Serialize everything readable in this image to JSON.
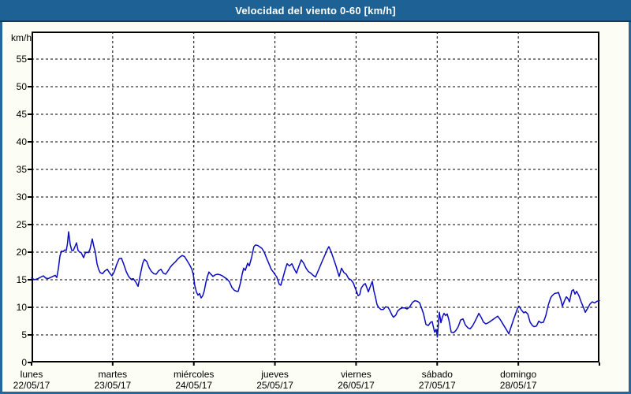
{
  "window": {
    "title": "Velocidad del viento 0-60 [km/h]"
  },
  "colors": {
    "header_bg": "#1e6295",
    "header_border": "#0e3c5f",
    "frame_border": "#28679c",
    "content_bg": "#fcfdf5",
    "plot_bg": "#ffffff",
    "grid": "#000000",
    "axis": "#000000",
    "line": "#0b0bc0"
  },
  "chart_data": {
    "type": "line",
    "title": "Velocidad del viento 0-60 [km/h]",
    "ylabel": "km/h",
    "ylim": [
      0,
      60
    ],
    "ytick_step": 5,
    "ytick_labels": [
      0,
      5,
      10,
      15,
      20,
      25,
      30,
      35,
      40,
      45,
      50,
      55
    ],
    "grid": "dashed",
    "legend": "none",
    "x_days": [
      {
        "name": "lunes",
        "date": "22/05/17"
      },
      {
        "name": "martes",
        "date": "23/05/17"
      },
      {
        "name": "miércoles",
        "date": "24/05/17"
      },
      {
        "name": "jueves",
        "date": "25/05/17"
      },
      {
        "name": "viernes",
        "date": "26/05/17"
      },
      {
        "name": "sábado",
        "date": "27/05/17"
      },
      {
        "name": "domingo",
        "date": "28/05/17"
      }
    ],
    "xlim_days": [
      0,
      7
    ],
    "series": [
      {
        "name": "Velocidad del viento",
        "units": "km/h",
        "points": [
          [
            0,
            15.3
          ],
          [
            0.039,
            15
          ],
          [
            0.078,
            15.2
          ],
          [
            0.117,
            15.5
          ],
          [
            0.146,
            15.7
          ],
          [
            0.175,
            15.3
          ],
          [
            0.204,
            15.2
          ],
          [
            0.233,
            15.4
          ],
          [
            0.262,
            15.6
          ],
          [
            0.292,
            15.8
          ],
          [
            0.311,
            15.4
          ],
          [
            0.331,
            17
          ],
          [
            0.35,
            19.3
          ],
          [
            0.369,
            20.2
          ],
          [
            0.389,
            20.1
          ],
          [
            0.408,
            20.4
          ],
          [
            0.428,
            20.3
          ],
          [
            0.442,
            21.5
          ],
          [
            0.457,
            23.7
          ],
          [
            0.476,
            21.4
          ],
          [
            0.496,
            20.3
          ],
          [
            0.515,
            20.3
          ],
          [
            0.535,
            21
          ],
          [
            0.554,
            21.7
          ],
          [
            0.574,
            20.3
          ],
          [
            0.593,
            20
          ],
          [
            0.612,
            19.9
          ],
          [
            0.642,
            19
          ],
          [
            0.661,
            19.8
          ],
          [
            0.681,
            20
          ],
          [
            0.7,
            19.9
          ],
          [
            0.719,
            20.5
          ],
          [
            0.749,
            22.4
          ],
          [
            0.768,
            21
          ],
          [
            0.787,
            20
          ],
          [
            0.807,
            17.9
          ],
          [
            0.826,
            16.9
          ],
          [
            0.846,
            16.3
          ],
          [
            0.875,
            16.1
          ],
          [
            0.904,
            16.6
          ],
          [
            0.933,
            16.9
          ],
          [
            0.963,
            16.2
          ],
          [
            0.992,
            15.7
          ],
          [
            1.021,
            16.5
          ],
          [
            1.05,
            17.8
          ],
          [
            1.079,
            18.8
          ],
          [
            1.108,
            18.9
          ],
          [
            1.137,
            17.8
          ],
          [
            1.167,
            16.5
          ],
          [
            1.196,
            15.6
          ],
          [
            1.225,
            15.1
          ],
          [
            1.254,
            15.2
          ],
          [
            1.283,
            14.6
          ],
          [
            1.313,
            13.8
          ],
          [
            1.342,
            16
          ],
          [
            1.371,
            18
          ],
          [
            1.39,
            18.7
          ],
          [
            1.42,
            18.3
          ],
          [
            1.449,
            17.2
          ],
          [
            1.478,
            16.5
          ],
          [
            1.507,
            16.1
          ],
          [
            1.536,
            16
          ],
          [
            1.565,
            16.6
          ],
          [
            1.595,
            16.9
          ],
          [
            1.624,
            16.2
          ],
          [
            1.653,
            16
          ],
          [
            1.682,
            16.6
          ],
          [
            1.711,
            17.3
          ],
          [
            1.74,
            17.8
          ],
          [
            1.77,
            18.2
          ],
          [
            1.799,
            18.7
          ],
          [
            1.828,
            19.1
          ],
          [
            1.857,
            19.4
          ],
          [
            1.886,
            19.2
          ],
          [
            1.915,
            18.5
          ],
          [
            1.944,
            17.8
          ],
          [
            1.974,
            17
          ],
          [
            1.993,
            16
          ],
          [
            2.012,
            14
          ],
          [
            2.032,
            12.8
          ],
          [
            2.051,
            12.2
          ],
          [
            2.071,
            12.5
          ],
          [
            2.09,
            11.7
          ],
          [
            2.11,
            12.1
          ],
          [
            2.129,
            13
          ],
          [
            2.149,
            14.5
          ],
          [
            2.168,
            15.6
          ],
          [
            2.187,
            16.4
          ],
          [
            2.217,
            15.9
          ],
          [
            2.236,
            15.6
          ],
          [
            2.265,
            15.9
          ],
          [
            2.294,
            16
          ],
          [
            2.324,
            15.9
          ],
          [
            2.353,
            15.7
          ],
          [
            2.382,
            15.4
          ],
          [
            2.411,
            15.1
          ],
          [
            2.44,
            14.6
          ],
          [
            2.469,
            13.6
          ],
          [
            2.499,
            13.1
          ],
          [
            2.528,
            12.9
          ],
          [
            2.547,
            12.9
          ],
          [
            2.576,
            14.5
          ],
          [
            2.596,
            16
          ],
          [
            2.615,
            17.1
          ],
          [
            2.635,
            16.7
          ],
          [
            2.664,
            18
          ],
          [
            2.683,
            17.5
          ],
          [
            2.712,
            19
          ],
          [
            2.741,
            21
          ],
          [
            2.761,
            21.3
          ],
          [
            2.79,
            21.2
          ],
          [
            2.819,
            20.9
          ],
          [
            2.839,
            20.7
          ],
          [
            2.868,
            20
          ],
          [
            2.897,
            18.9
          ],
          [
            2.926,
            17.9
          ],
          [
            2.955,
            16.9
          ],
          [
            2.985,
            16.3
          ],
          [
            3.023,
            15.5
          ],
          [
            3.053,
            14.2
          ],
          [
            3.072,
            14
          ],
          [
            3.101,
            15.5
          ],
          [
            3.13,
            17
          ],
          [
            3.15,
            17.9
          ],
          [
            3.179,
            17.5
          ],
          [
            3.208,
            17.9
          ],
          [
            3.237,
            17
          ],
          [
            3.266,
            16.2
          ],
          [
            3.296,
            17.5
          ],
          [
            3.325,
            18.6
          ],
          [
            3.354,
            18
          ],
          [
            3.383,
            17.1
          ],
          [
            3.412,
            16.5
          ],
          [
            3.442,
            16.2
          ],
          [
            3.471,
            15.8
          ],
          [
            3.5,
            15.5
          ],
          [
            3.529,
            16.5
          ],
          [
            3.558,
            17.5
          ],
          [
            3.587,
            18.5
          ],
          [
            3.617,
            19.5
          ],
          [
            3.646,
            20.5
          ],
          [
            3.665,
            21
          ],
          [
            3.694,
            20
          ],
          [
            3.723,
            18.8
          ],
          [
            3.753,
            17.5
          ],
          [
            3.772,
            16.5
          ],
          [
            3.792,
            15.6
          ],
          [
            3.821,
            17.1
          ],
          [
            3.85,
            16.3
          ],
          [
            3.879,
            16
          ],
          [
            3.908,
            15.2
          ],
          [
            3.937,
            15
          ],
          [
            3.967,
            14.4
          ],
          [
            3.986,
            13.6
          ],
          [
            4.006,
            12.9
          ],
          [
            4.025,
            12.1
          ],
          [
            4.045,
            12.3
          ],
          [
            4.064,
            13.5
          ],
          [
            4.093,
            14.1
          ],
          [
            4.113,
            14.3
          ],
          [
            4.132,
            13.6
          ],
          [
            4.151,
            12.8
          ],
          [
            4.171,
            13.6
          ],
          [
            4.2,
            14.7
          ],
          [
            4.219,
            13
          ],
          [
            4.238,
            11.9
          ],
          [
            4.258,
            10.5
          ],
          [
            4.278,
            10
          ],
          [
            4.307,
            9.6
          ],
          [
            4.336,
            9.6
          ],
          [
            4.365,
            10.1
          ],
          [
            4.394,
            10
          ],
          [
            4.414,
            9.5
          ],
          [
            4.443,
            8.6
          ],
          [
            4.462,
            8.2
          ],
          [
            4.491,
            8.6
          ],
          [
            4.511,
            9.3
          ],
          [
            4.54,
            9.7
          ],
          [
            4.569,
            9.9
          ],
          [
            4.598,
            9.9
          ],
          [
            4.628,
            9.7
          ],
          [
            4.657,
            10
          ],
          [
            4.696,
            10.9
          ],
          [
            4.725,
            11.2
          ],
          [
            4.754,
            11.1
          ],
          [
            4.783,
            10.8
          ],
          [
            4.812,
            9.7
          ],
          [
            4.832,
            8.8
          ],
          [
            4.861,
            6.9
          ],
          [
            4.89,
            6.7
          ],
          [
            4.919,
            7.3
          ],
          [
            4.938,
            7.4
          ],
          [
            4.968,
            5.5
          ],
          [
            4.987,
            6
          ],
          [
            5.002,
            4.6
          ],
          [
            5.026,
            9.1
          ],
          [
            5.046,
            7.2
          ],
          [
            5.065,
            8.3
          ],
          [
            5.085,
            8.9
          ],
          [
            5.104,
            8.5
          ],
          [
            5.124,
            8.8
          ],
          [
            5.143,
            7.8
          ],
          [
            5.172,
            5.5
          ],
          [
            5.202,
            5.4
          ],
          [
            5.231,
            5.8
          ],
          [
            5.26,
            6.5
          ],
          [
            5.289,
            7.7
          ],
          [
            5.318,
            7.9
          ],
          [
            5.347,
            6.8
          ],
          [
            5.377,
            6.3
          ],
          [
            5.406,
            6.1
          ],
          [
            5.435,
            6.6
          ],
          [
            5.464,
            7.4
          ],
          [
            5.494,
            8.3
          ],
          [
            5.513,
            8.9
          ],
          [
            5.542,
            8.2
          ],
          [
            5.571,
            7.3
          ],
          [
            5.6,
            7
          ],
          [
            5.63,
            7.2
          ],
          [
            5.659,
            7.5
          ],
          [
            5.688,
            7.8
          ],
          [
            5.717,
            8.1
          ],
          [
            5.746,
            8.4
          ],
          [
            5.776,
            7.8
          ],
          [
            5.805,
            7.1
          ],
          [
            5.834,
            6.4
          ],
          [
            5.863,
            5.7
          ],
          [
            5.883,
            5.2
          ],
          [
            5.912,
            6.5
          ],
          [
            5.941,
            7.8
          ],
          [
            5.97,
            9
          ],
          [
            5.99,
            9.8
          ],
          [
            6.009,
            10.2
          ],
          [
            6.038,
            9.5
          ],
          [
            6.068,
            9
          ],
          [
            6.087,
            9.2
          ],
          [
            6.116,
            8.8
          ],
          [
            6.145,
            7.3
          ],
          [
            6.174,
            6.7
          ],
          [
            6.194,
            6.5
          ],
          [
            6.223,
            6.6
          ],
          [
            6.252,
            7.5
          ],
          [
            6.281,
            7.2
          ],
          [
            6.31,
            7.3
          ],
          [
            6.339,
            8.5
          ],
          [
            6.369,
            10.4
          ],
          [
            6.398,
            11.7
          ],
          [
            6.417,
            12.1
          ],
          [
            6.446,
            12.5
          ],
          [
            6.475,
            12.6
          ],
          [
            6.495,
            12.7
          ],
          [
            6.524,
            11.4
          ],
          [
            6.543,
            10.2
          ],
          [
            6.572,
            11.3
          ],
          [
            6.592,
            11.9
          ],
          [
            6.611,
            11.6
          ],
          [
            6.631,
            11
          ],
          [
            6.66,
            13
          ],
          [
            6.679,
            13.2
          ],
          [
            6.699,
            12.4
          ],
          [
            6.718,
            12.9
          ],
          [
            6.747,
            12.1
          ],
          [
            6.776,
            10.9
          ],
          [
            6.806,
            9.9
          ],
          [
            6.825,
            9.1
          ],
          [
            6.854,
            9.8
          ],
          [
            6.883,
            10.6
          ],
          [
            6.912,
            11
          ],
          [
            6.941,
            10.8
          ],
          [
            6.971,
            11.1
          ],
          [
            7,
            11.2
          ]
        ]
      }
    ]
  }
}
